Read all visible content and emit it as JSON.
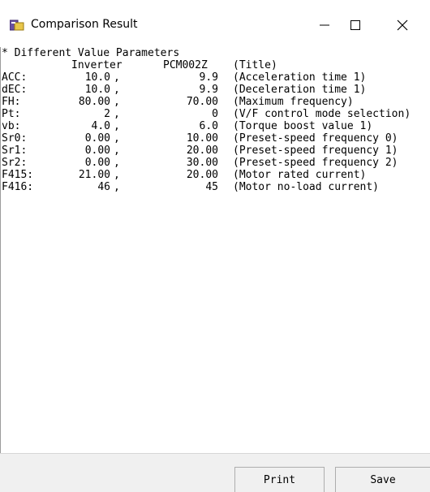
{
  "window": {
    "title": "Comparison Result",
    "app_icon": "comparison-app-icon",
    "controls": {
      "minimize_icon": "minimize-icon",
      "maximize_icon": "maximize-icon",
      "close_icon": "close-icon"
    }
  },
  "result": {
    "heading": "* Different Value Parameters",
    "columns": {
      "inverter": "Inverter",
      "pcm": "PCM002Z",
      "title": "(Title)"
    },
    "rows": [
      {
        "name": "ACC:",
        "inverter": "10.0",
        "sep": ",",
        "pcm": "9.9",
        "desc": "(Acceleration time 1)"
      },
      {
        "name": "dEC:",
        "inverter": "10.0",
        "sep": ",",
        "pcm": "9.9",
        "desc": "(Deceleration time 1)"
      },
      {
        "name": "FH:",
        "inverter": "80.00",
        "sep": ",",
        "pcm": "70.00",
        "desc": "(Maximum frequency)"
      },
      {
        "name": "Pt:",
        "inverter": "2",
        "sep": ",",
        "pcm": "0",
        "desc": "(V/F control mode selection)"
      },
      {
        "name": "vb:",
        "inverter": "4.0",
        "sep": ",",
        "pcm": "6.0",
        "desc": "(Torque boost value 1)"
      },
      {
        "name": "Sr0:",
        "inverter": "0.00",
        "sep": ",",
        "pcm": "10.00",
        "desc": "(Preset-speed frequency 0)"
      },
      {
        "name": "Sr1:",
        "inverter": "0.00",
        "sep": ",",
        "pcm": "20.00",
        "desc": "(Preset-speed frequency 1)"
      },
      {
        "name": "Sr2:",
        "inverter": "0.00",
        "sep": ",",
        "pcm": "30.00",
        "desc": "(Preset-speed frequency 2)"
      },
      {
        "name": "F415:",
        "inverter": "21.00",
        "sep": ",",
        "pcm": "20.00",
        "desc": "(Motor rated current)"
      },
      {
        "name": "F416:",
        "inverter": "46",
        "sep": ",",
        "pcm": "45",
        "desc": "(Motor no-load current)"
      }
    ]
  },
  "footer": {
    "print_label": "Print",
    "save_label": "Save"
  }
}
